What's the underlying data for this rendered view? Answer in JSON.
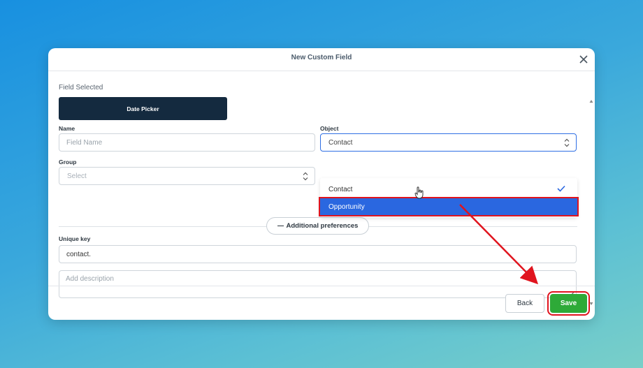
{
  "modal": {
    "title": "New Custom Field"
  },
  "field_selected": {
    "label": "Field Selected",
    "button_label": "Date Picker"
  },
  "name_field": {
    "label": "Name",
    "placeholder": "Field Name",
    "value": ""
  },
  "object_field": {
    "label": "Object",
    "value": "Contact",
    "options": [
      {
        "label": "Contact",
        "selected": true
      },
      {
        "label": "Opportunity",
        "selected": false
      }
    ]
  },
  "group_field": {
    "label": "Group",
    "placeholder": "Select"
  },
  "additional_preferences": {
    "label": "Additional preferences"
  },
  "unique_key": {
    "label": "Unique key",
    "value": "contact."
  },
  "description": {
    "placeholder": "Add description"
  },
  "footer": {
    "back_label": "Back",
    "save_label": "Save"
  },
  "colors": {
    "primary": "#2a67e0",
    "save": "#2eaa38",
    "date_picker_bg": "#142a3f",
    "annotation_red": "#e0141e"
  }
}
